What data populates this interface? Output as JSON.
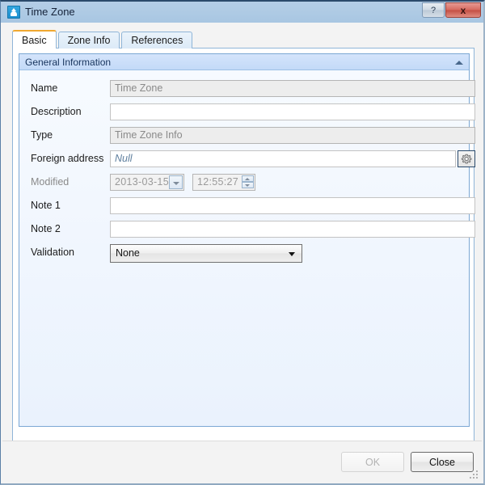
{
  "window": {
    "title": "Time Zone",
    "icon": "app-icon",
    "buttons": {
      "help": "?",
      "close": "x"
    }
  },
  "tabs": [
    {
      "label": "Basic",
      "active": true
    },
    {
      "label": "Zone Info",
      "active": false
    },
    {
      "label": "References",
      "active": false
    }
  ],
  "group": {
    "title": "General Information",
    "collapse_icon": "chevron-up-icon"
  },
  "fields": {
    "name": {
      "label": "Name",
      "value": "Time Zone",
      "readonly": true
    },
    "description": {
      "label": "Description",
      "value": "",
      "readonly": false
    },
    "type": {
      "label": "Type",
      "value": "Time Zone Info",
      "readonly": true
    },
    "foreign_address": {
      "label": "Foreign address",
      "value": "Null",
      "readonly": false,
      "button_icon": "gear-icon"
    },
    "modified": {
      "label": "Modified",
      "date": "2013-03-15",
      "time": "12:55:27",
      "disabled": true,
      "date_dropdown_icon": "chevron-down-icon",
      "time_spinner_icon": "spinner-icon"
    },
    "note1": {
      "label": "Note 1",
      "value": "",
      "readonly": false
    },
    "note2": {
      "label": "Note 2",
      "value": "",
      "readonly": false
    },
    "validation": {
      "label": "Validation",
      "value": "None",
      "options": [
        "None"
      ],
      "arrow_icon": "chevron-down-icon"
    }
  },
  "footer": {
    "ok_label": "OK",
    "ok_enabled": false,
    "close_label": "Close",
    "close_enabled": true,
    "resize_grip": "resize-grip-icon"
  },
  "colors": {
    "titlebar": "#aecae4",
    "tab_accent": "#f0a830",
    "group_header": "#c3daf8",
    "panel_bg": "#eef5fd",
    "close_button": "#d66a60",
    "null_text": "#5f7f9e"
  }
}
